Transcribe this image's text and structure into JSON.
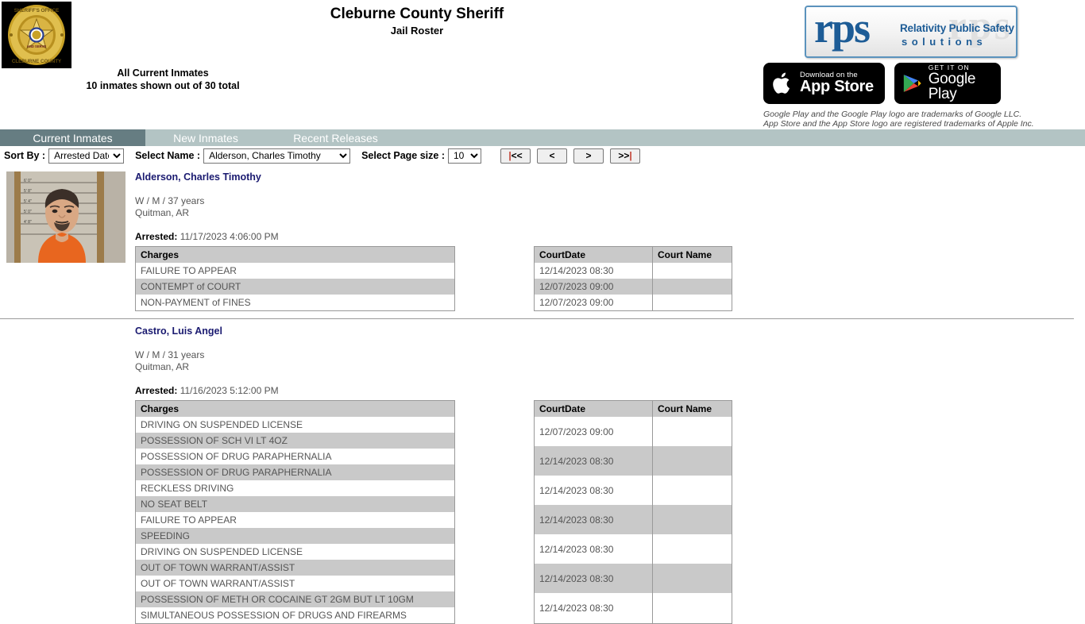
{
  "header": {
    "title": "Cleburne County Sheriff",
    "subtitle": "Jail Roster",
    "count_heading": "All Current Inmates",
    "count_detail": "10 inmates shown out of 30 total",
    "badge_top_text": "SHERIFF'S OFFICE",
    "badge_bottom_text": "CLEBURNE COUNTY",
    "logo": {
      "wordmark": "rps",
      "tagline_line1": "Relativity Public Safety",
      "tagline_line2": "solutions",
      "ghost_text": "rps"
    },
    "app_store": {
      "small_text": "Download on the",
      "big_text": "App Store"
    },
    "google_play": {
      "small_text": "GET IT ON",
      "big_text": "Google Play"
    },
    "trademark_line1": "Google Play and the Google Play logo are trademarks of Google LLC.",
    "trademark_line2": "App Store and the App Store logo are registered trademarks of Apple Inc."
  },
  "tabs": [
    {
      "label": "Current Inmates",
      "active": true
    },
    {
      "label": "New Inmates",
      "active": false
    },
    {
      "label": "Recent Releases",
      "active": false
    }
  ],
  "controls": {
    "sort_label": "Sort By :",
    "sort_value": "Arrested Date",
    "sort_options": [
      "Arrested Date"
    ],
    "name_label": "Select Name :",
    "name_value": "Alderson, Charles Timothy",
    "name_options": [
      "Alderson, Charles Timothy"
    ],
    "pagesize_label": "Select Page size :",
    "pagesize_value": "10",
    "pagesize_options": [
      "10"
    ],
    "pager": {
      "first": "|<<",
      "prev": "<",
      "next": ">",
      "last": ">>|"
    }
  },
  "table_headers": {
    "charges": "Charges",
    "court_date": "CourtDate",
    "court_name": "Court Name"
  },
  "inmates": [
    {
      "name": "Alderson, Charles Timothy",
      "demographics": "W / M / 37 years",
      "city": "Quitman, AR",
      "arrested_label": "Arrested:",
      "arrested_value": "11/17/2023 4:06:00 PM",
      "charges": [
        "FAILURE TO APPEAR",
        "CONTEMPT of COURT",
        "NON-PAYMENT of FINES"
      ],
      "courts": [
        {
          "date": "12/14/2023 08:30",
          "name": ""
        },
        {
          "date": "12/07/2023 09:00",
          "name": ""
        },
        {
          "date": "12/07/2023 09:00",
          "name": ""
        }
      ]
    },
    {
      "name": "Castro, Luis Angel",
      "demographics": "W / M / 31 years",
      "city": "Quitman, AR",
      "arrested_label": "Arrested:",
      "arrested_value": "11/16/2023 5:12:00 PM",
      "charges": [
        "DRIVING ON SUSPENDED LICENSE",
        "POSSESSION OF SCH VI LT 4OZ",
        "POSSESSION OF DRUG PARAPHERNALIA",
        "POSSESSION OF DRUG PARAPHERNALIA",
        "RECKLESS DRIVING",
        "NO SEAT BELT",
        "FAILURE TO APPEAR",
        "SPEEDING",
        "DRIVING ON SUSPENDED LICENSE",
        "OUT OF TOWN WARRANT/ASSIST",
        "OUT OF TOWN WARRANT/ASSIST",
        "POSSESSION OF METH OR COCAINE GT 2GM BUT LT 10GM",
        "SIMULTANEOUS POSSESSION OF DRUGS AND FIREARMS"
      ],
      "courts": [
        {
          "date": "12/07/2023 09:00",
          "name": ""
        },
        {
          "date": "12/14/2023 08:30",
          "name": ""
        },
        {
          "date": "12/14/2023 08:30",
          "name": ""
        },
        {
          "date": "12/14/2023 08:30",
          "name": ""
        },
        {
          "date": "12/14/2023 08:30",
          "name": ""
        },
        {
          "date": "12/14/2023 08:30",
          "name": ""
        },
        {
          "date": "12/14/2023 08:30",
          "name": ""
        }
      ]
    }
  ],
  "colors": {
    "tab_active": "#667d82",
    "tab_bar": "#b3c4c4",
    "link": "#1a1a70",
    "table_header": "#c9c9c9",
    "row_alt": "#c9c9c9",
    "logo_blue": "#1d5c96"
  }
}
